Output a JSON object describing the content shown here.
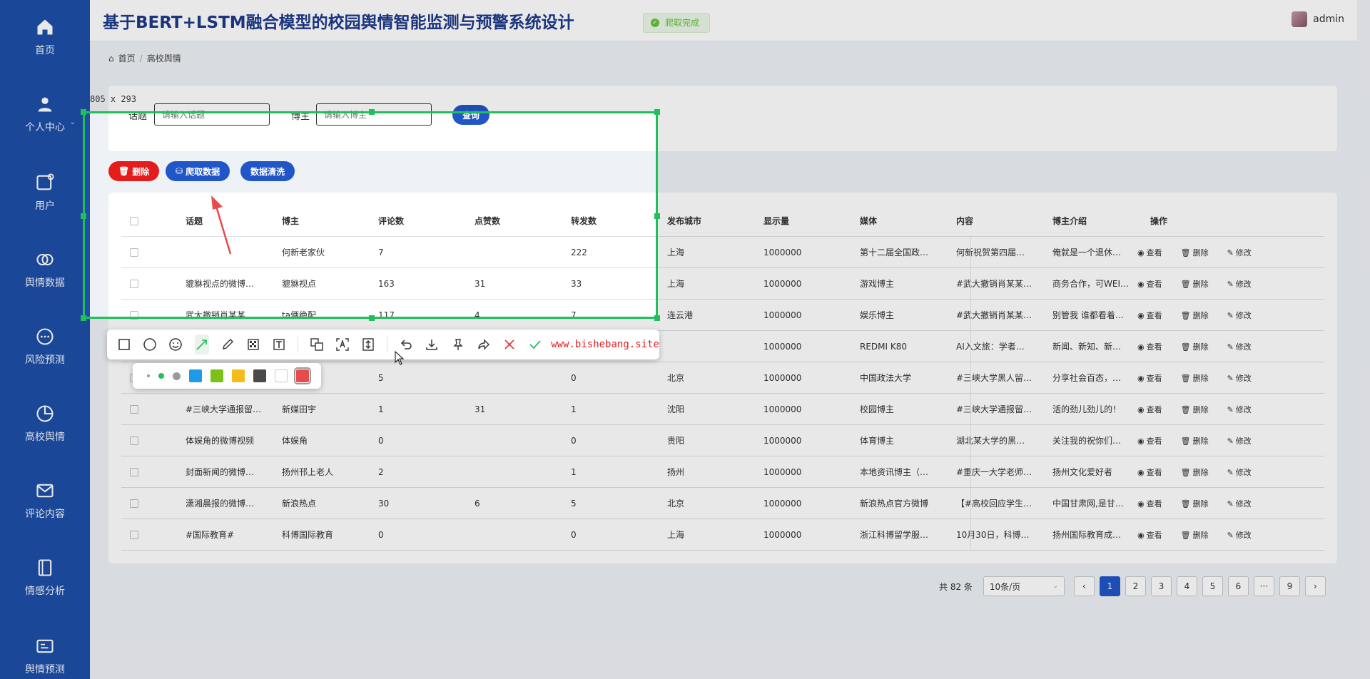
{
  "sidebar": {
    "items": [
      {
        "label": "首页",
        "icon": "home-icon"
      },
      {
        "label": "个人中心",
        "icon": "person-icon"
      },
      {
        "label": "用户",
        "icon": "user-card-icon"
      },
      {
        "label": "舆情数据",
        "icon": "link-icon"
      },
      {
        "label": "风险预测",
        "icon": "chat-icon"
      },
      {
        "label": "高校舆情",
        "icon": "pie-icon"
      },
      {
        "label": "评论内容",
        "icon": "mail-icon"
      },
      {
        "label": "情感分析",
        "icon": "notebook-icon"
      },
      {
        "label": "舆情预测",
        "icon": "forecast-icon"
      }
    ]
  },
  "header": {
    "title": "基于BERT+LSTM融合模型的校园舆情智能监测与预警系统设计",
    "toast": "爬取完成",
    "user": "admin"
  },
  "breadcrumb": {
    "home": "首页",
    "sep": "/",
    "current": "高校舆情"
  },
  "search": {
    "topic_label": "话题",
    "topic_placeholder": "请输入话题",
    "blogger_label": "博主",
    "blogger_placeholder": "请输入博主",
    "query_button": "查询"
  },
  "actions": {
    "delete": "删除",
    "crawl": "爬取数据",
    "clean": "数据清洗"
  },
  "table": {
    "headers": [
      "话题",
      "博主",
      "评论数",
      "点赞数",
      "转发数",
      "发布城市",
      "显示量",
      "媒体",
      "内容",
      "博主介绍",
      "操作"
    ],
    "op_labels": {
      "view": "查看",
      "delete": "删除",
      "edit": "修改"
    },
    "rows": [
      [
        "",
        "何新老家伙",
        "7",
        "",
        "222",
        "上海",
        "1000000",
        "第十二届全国政…",
        "何新祝贺第四届…",
        "俺就是一个退休…"
      ],
      [
        "貔貅视点的微博…",
        "貔貅视点",
        "163",
        "31",
        "33",
        "上海",
        "1000000",
        "游戏博主",
        "#武大撤销肖某某…",
        "商务合作，可WEI…"
      ],
      [
        "武大撤销肖某某…",
        "ta俩绝配",
        "117",
        "4",
        "7",
        "连云港",
        "1000000",
        "娱乐博主",
        "#武大撤销肖某某…",
        "别管我 谁都看着…"
      ],
      [
        "",
        "",
        "",
        "",
        "",
        "",
        "1000000",
        "REDMI K80",
        "AI入文旅：学者…",
        "新闻、新知、新…"
      ],
      [
        "",
        "",
        "5",
        "",
        "0",
        "北京",
        "1000000",
        "中国政法大学",
        "#三峡大学黑人留…",
        "分享社会百态，…"
      ],
      [
        "#三峡大学通报留…",
        "新媒田宇",
        "1",
        "31",
        "1",
        "沈阳",
        "1000000",
        "校园博主",
        "#三峡大学通报留…",
        "活的劲儿劲儿的！"
      ],
      [
        "体娱角的微博视频",
        "体娱角",
        "0",
        "",
        "0",
        "贵阳",
        "1000000",
        "体育博主",
        "湖北某大学的黑…",
        "关注我的祝你们…"
      ],
      [
        "封面新闻的微博…",
        "扬州邗上老人",
        "2",
        "",
        "1",
        "扬州",
        "1000000",
        "本地资讯博主（…",
        "#重庆一大学老师…",
        "扬州文化爱好者"
      ],
      [
        "潇湘晨报的微博…",
        "新浪热点",
        "30",
        "6",
        "5",
        "北京",
        "1000000",
        "新浪热点官方微博",
        "【#高校回应学生…",
        "中国甘肃网,是甘…"
      ],
      [
        "#国际教育#",
        "科博国际教育",
        "0",
        "",
        "0",
        "上海",
        "1000000",
        "浙江科博留学服…",
        "10月30日，科博…",
        "扬州国际教育成…"
      ]
    ]
  },
  "pagination": {
    "total": "共 82 条",
    "page_size": "10条/页",
    "pages": [
      "1",
      "2",
      "3",
      "4",
      "5",
      "6",
      "···",
      "9"
    ],
    "current": "1"
  },
  "capture": {
    "size_readout": "805 x 293",
    "watermark": "www.bishebang.site",
    "accent_color": "#1fbf5b",
    "arrow_color": "#e84b4b",
    "palette": [
      "#1e9be8",
      "#7ac21b",
      "#f6bc1b",
      "#4a4a4a",
      "#ffffff",
      "#e84b4b"
    ]
  }
}
